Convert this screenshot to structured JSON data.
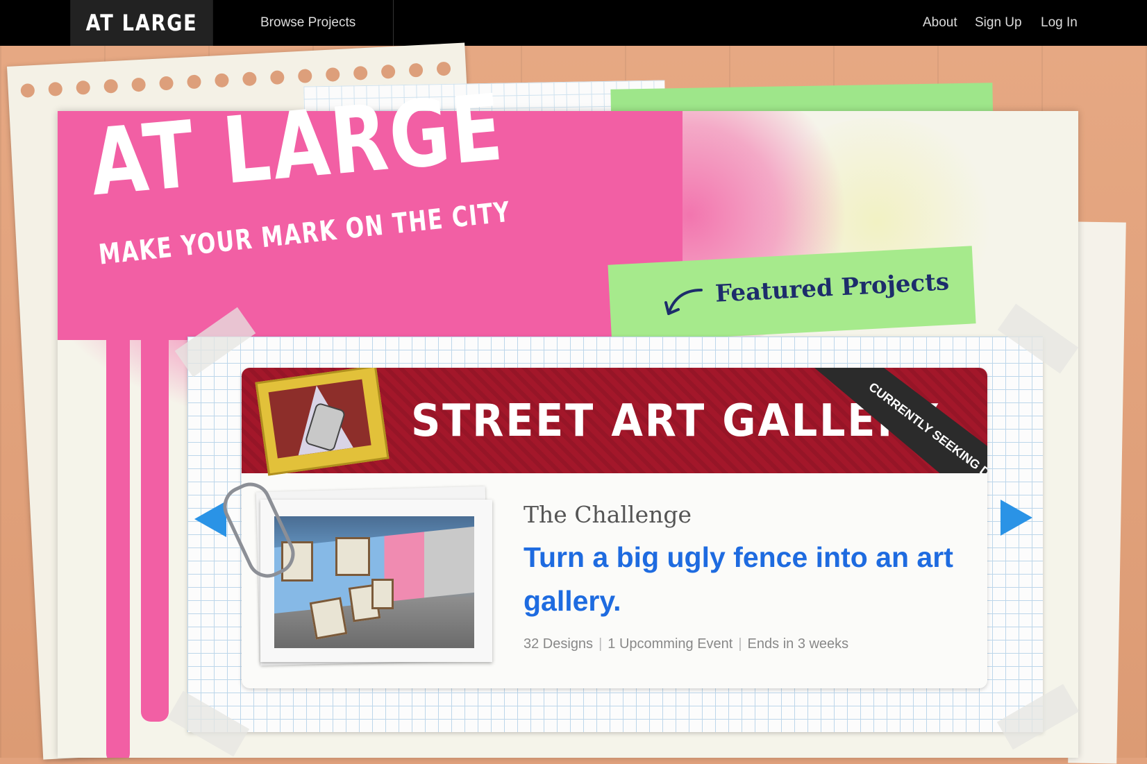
{
  "nav": {
    "brand": "AT LARGE",
    "browse_projects": "Browse Projects",
    "about": "About",
    "sign_up": "Sign Up",
    "log_in": "Log In"
  },
  "hero": {
    "title": "AT LARGE",
    "tagline": "MAKE YOUR MARK ON THE CITY"
  },
  "featured": {
    "label": "Featured Projects"
  },
  "project": {
    "banner_title": "STREET ART GALLERY",
    "ribbon": "CURRENTLY SEEKING DESIGNS",
    "challenge_label": "The Challenge",
    "challenge_text": "Turn a big ugly fence into an art gallery.",
    "stats": [
      "32 Designs",
      "1 Upcomming Event",
      "Ends in 3 weeks"
    ]
  },
  "colors": {
    "accent_pink": "#f25fa4",
    "accent_green": "#a6ea8c",
    "banner_red": "#a3172a",
    "link_blue": "#1e6be0",
    "arrow_blue": "#2a93e6"
  },
  "icons": {
    "prev": "triangle-left-icon",
    "next": "triangle-right-icon",
    "featured_arrow": "curved-arrow-icon"
  }
}
